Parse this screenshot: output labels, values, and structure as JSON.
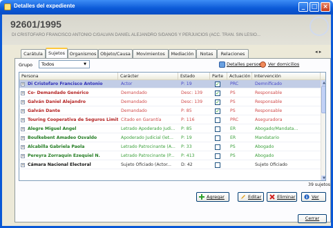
{
  "window": {
    "title": "Detalles del expediente",
    "controls": [
      "_",
      "□",
      "×"
    ]
  },
  "header": {
    "case_number": "92601/1995",
    "case_title": "DI CRISTOFARO FRANCISCO ANTONIO C/GALVAN DANIEL ALEJANDRO S/DAÑOS Y PERJUICIOS (ACC. TRAN. SIN LESIO..."
  },
  "tabs": [
    {
      "label": "Carátula",
      "active": false
    },
    {
      "label": "Sujetos",
      "active": true
    },
    {
      "label": "Organismos",
      "active": false
    },
    {
      "label": "Objeto/Causa",
      "active": false
    },
    {
      "label": "Movimientos",
      "active": false
    },
    {
      "label": "Mediación",
      "active": false
    },
    {
      "label": "Notas",
      "active": false
    },
    {
      "label": "Relaciones",
      "active": false
    }
  ],
  "tab_scroll": "◂ ▸",
  "toolbar": {
    "grupo_label": "Grupo",
    "grupo_value": "Todos",
    "detalles_label": "Detalles persona",
    "ver_label": "Ver domicilios"
  },
  "grid": {
    "columns": [
      "Persona",
      "Carácter",
      "Estado",
      "Parte",
      "Actuación",
      "Intervención"
    ],
    "rows": [
      {
        "persona": "Di Cristofaro Francisco Antonio",
        "caracter": "Actor",
        "estado": "P: 19",
        "parte": true,
        "actuacion": "PRC",
        "intervencion": "Demnificado",
        "color": "#2e2eb8",
        "selected": true
      },
      {
        "persona": "Co- Demandado Genérico",
        "caracter": "Demandado",
        "estado": "Desc: 139",
        "parte": true,
        "actuacion": "PS",
        "intervencion": "Responsable",
        "color": "#b32121",
        "selected": false
      },
      {
        "persona": "Galván Daniel Alejandro",
        "caracter": "Demandado",
        "estado": "Desc: 139",
        "parte": true,
        "actuacion": "PS",
        "intervencion": "Responsable",
        "color": "#b32121",
        "selected": false
      },
      {
        "persona": "Galván Dante",
        "caracter": "Demandado",
        "estado": "P: 85",
        "parte": true,
        "actuacion": "PS",
        "intervencion": "Responsable",
        "color": "#b32121",
        "selected": false
      },
      {
        "persona": "Touring Cooperativa de Seguros Limitada",
        "caracter": "Citado en Garantía",
        "estado": "P: 116",
        "parte": false,
        "actuacion": "PRC",
        "intervencion": "Aseguradora",
        "color": "#b32121",
        "selected": false
      },
      {
        "persona": "Alegre Miguel Angel",
        "caracter": "Letrado Apoderado Judi...",
        "estado": "P: 85",
        "parte": false,
        "actuacion": "ER",
        "intervencion": "Abogado/Mandata...",
        "color": "#1f7a1f",
        "selected": false
      },
      {
        "persona": "Boulkebent Amadeo Osvaldo",
        "caracter": "Apoderado Judicial (let...",
        "estado": "P: 19",
        "parte": false,
        "actuacion": "ER",
        "intervencion": "Mandatario",
        "color": "#1f7a1f",
        "selected": false
      },
      {
        "persona": "Alcabilla Gabriela Paola",
        "caracter": "Letrado Patrocinante (A...",
        "estado": "P: 33",
        "parte": false,
        "actuacion": "PS",
        "intervencion": "Abogado",
        "color": "#1f7a1f",
        "selected": false
      },
      {
        "persona": "Pereyra Zorraquín Ezequiel N.",
        "caracter": "Letrado Patrocinante (P...",
        "estado": "P: 413",
        "parte": false,
        "actuacion": "PS",
        "intervencion": "Abogado",
        "color": "#1f7a1f",
        "selected": false
      },
      {
        "persona": "Cámara Nacional Electoral",
        "caracter": "Sujeto Oficiado (Actor...",
        "estado": "D: 42",
        "parte": false,
        "actuacion": "",
        "intervencion": "Sujeto Oficiado",
        "color": "#111111",
        "selected": false
      }
    ]
  },
  "count_label": "39 sujetos",
  "actions": {
    "agregar": "Agregar",
    "editar": "Editar",
    "eliminar": "Eliminar",
    "ver": "Ver"
  },
  "cerrar_label": "Cerrar"
}
